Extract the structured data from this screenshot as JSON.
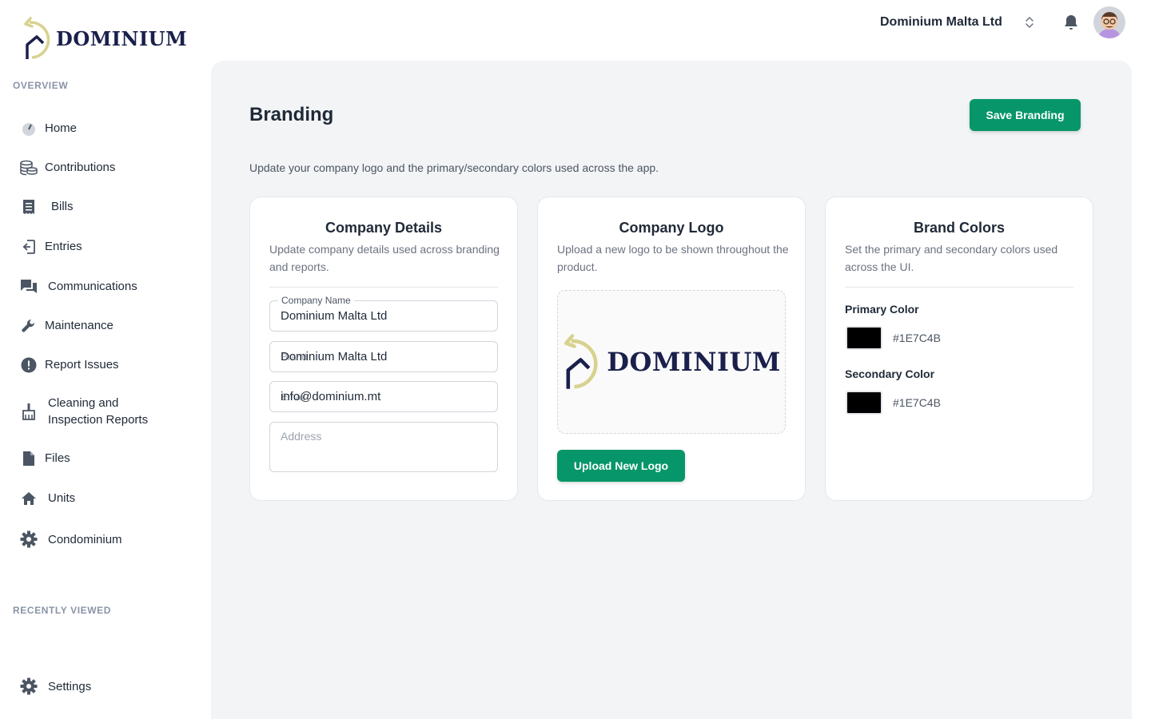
{
  "brand": {
    "name": "Dominium"
  },
  "sidebar": {
    "overview_label": "OVERVIEW",
    "recently_viewed_label": "RECENTLY VIEWED",
    "items": [
      {
        "label": "Home",
        "icon": "dashboard-icon"
      },
      {
        "label": "Contributions",
        "icon": "coins-icon"
      },
      {
        "label": "Bills",
        "icon": "receipt-icon"
      },
      {
        "label": "Entries",
        "icon": "login-icon"
      },
      {
        "label": "Communications",
        "icon": "chat-icon"
      },
      {
        "label": "Maintenance",
        "icon": "wrench-icon"
      },
      {
        "label": "Report Issues",
        "icon": "alert-icon"
      },
      {
        "label": "Cleaning and Inspection Reports",
        "icon": "broom-icon"
      },
      {
        "label": "Files",
        "icon": "file-icon"
      },
      {
        "label": "Units",
        "icon": "home-icon"
      },
      {
        "label": "Condominium",
        "icon": "gear-icon"
      }
    ],
    "settings_label": "Settings"
  },
  "header": {
    "organization": "Dominium Malta Ltd"
  },
  "page": {
    "title": "Branding",
    "save_label": "Save Branding",
    "description": "Update your company logo and the primary/secondary colors used across the app."
  },
  "company_details": {
    "title": "Company Details",
    "description": "Update company details used across branding and reports.",
    "company_name_label": "Company Name",
    "company_name_value": "Dominium Malta Ltd",
    "second_field_ghost": "Brand",
    "second_field_value": "Dominium Malta Ltd",
    "email_ghost": "Email",
    "email_value": "info@dominium.mt",
    "address_placeholder": "Address"
  },
  "company_logo": {
    "title": "Company Logo",
    "description": "Upload a new logo to be shown throughout the product.",
    "upload_label": "Upload New Logo"
  },
  "brand_colors": {
    "title": "Brand Colors",
    "description": "Set the primary and secondary colors used across the UI.",
    "primary_label": "Primary Color",
    "primary_hex": "#1E7C4B",
    "secondary_label": "Secondary Color",
    "secondary_hex": "#1E7C4B"
  },
  "colors": {
    "accent_green": "#079669",
    "logo_navy": "#1a1f4b",
    "logo_gold": "#d8d28f",
    "panel_bg": "#f3f4f6"
  }
}
